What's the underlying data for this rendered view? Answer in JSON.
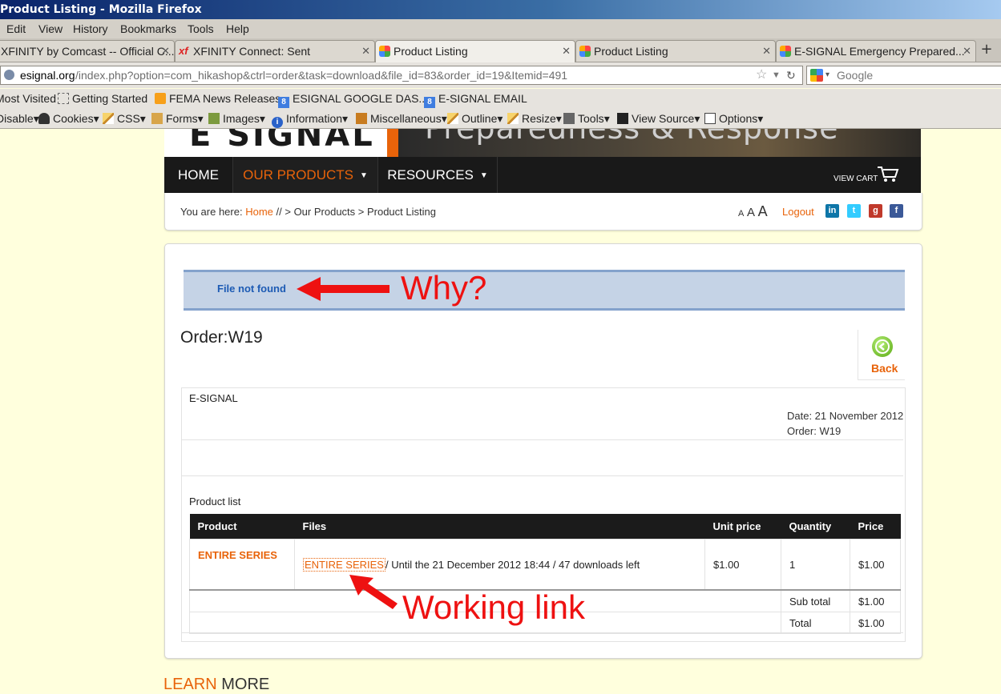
{
  "window": {
    "title": "Product Listing - Mozilla Firefox"
  },
  "menu": [
    "Edit",
    "View",
    "History",
    "Bookmarks",
    "Tools",
    "Help"
  ],
  "tabs": [
    {
      "label": "XFINITY by Comcast -- Official C...",
      "active": false,
      "icon": "comcast-icon"
    },
    {
      "label": "XFINITY Connect: Sent",
      "active": false,
      "icon": "xfinity-icon"
    },
    {
      "label": "Product Listing",
      "active": true,
      "icon": "joomla-icon"
    },
    {
      "label": "Product Listing",
      "active": false,
      "icon": "joomla-icon"
    },
    {
      "label": "E-SIGNAL Emergency Prepared...",
      "active": false,
      "icon": "joomla-icon"
    }
  ],
  "urlbar": {
    "domain": "esignal.org",
    "path": "/index.php?option=com_hikashop&ctrl=order&task=download&file_id=83&order_id=19&Itemid=491"
  },
  "search": {
    "placeholder": "Google"
  },
  "bookmarks": [
    "Most Visited",
    "Getting Started",
    "FEMA News Releases",
    "ESIGNAL GOOGLE DAS...",
    "E-SIGNAL EMAIL"
  ],
  "devtoolbar": [
    "Disable",
    "Cookies",
    "CSS",
    "Forms",
    "Images",
    "Information",
    "Miscellaneous",
    "Outline",
    "Resize",
    "Tools",
    "View Source",
    "Options"
  ],
  "site": {
    "logo": "E SIGNAL",
    "tagline": "Preparedness & Response",
    "nav": [
      "HOME",
      "OUR PRODUCTS",
      "RESOURCES"
    ],
    "view_cart": "VIEW CART",
    "breadcrumb": {
      "prefix": "You are here:",
      "home": "Home",
      "rest": "// > Our Products > Product Listing"
    },
    "font_sizes": [
      "A",
      "A",
      "A"
    ],
    "logout": "Logout",
    "social": [
      {
        "icon": "linkedin-icon",
        "glyph": "in",
        "color": "#0e76a8"
      },
      {
        "icon": "twitter-icon",
        "glyph": "t",
        "color": "#33ccff"
      },
      {
        "icon": "googleplus-icon",
        "glyph": "g",
        "color": "#c0392b"
      },
      {
        "icon": "facebook-icon",
        "glyph": "f",
        "color": "#3b5998"
      }
    ]
  },
  "message": "File not found",
  "order": {
    "title": "Order:W19",
    "back": "Back",
    "company": "E-SIGNAL",
    "date": "Date: 21 November 2012",
    "order_no": "Order: W19",
    "product_list_label": "Product list",
    "columns": [
      "Product",
      "Files",
      "Unit price",
      "Quantity",
      "Price"
    ],
    "rows": [
      {
        "product": "ENTIRE SERIES",
        "file_link": "ENTIRE SERIES",
        "file_info": "/ Until the 21 December 2012 18:44 / 47 downloads left",
        "unit_price": "$1.00",
        "quantity": "1",
        "price": "$1.00"
      }
    ],
    "subtotal_label": "Sub total",
    "subtotal": "$1.00",
    "total_label": "Total",
    "total": "$1.00"
  },
  "learn_more": {
    "a": "LEARN",
    "b": "MORE"
  },
  "annotations": {
    "why": "Why?",
    "working": "Working link"
  },
  "colors": {
    "accent": "#e8630a",
    "annotation": "#ee1111",
    "message_bg": "#c5d3e6"
  }
}
